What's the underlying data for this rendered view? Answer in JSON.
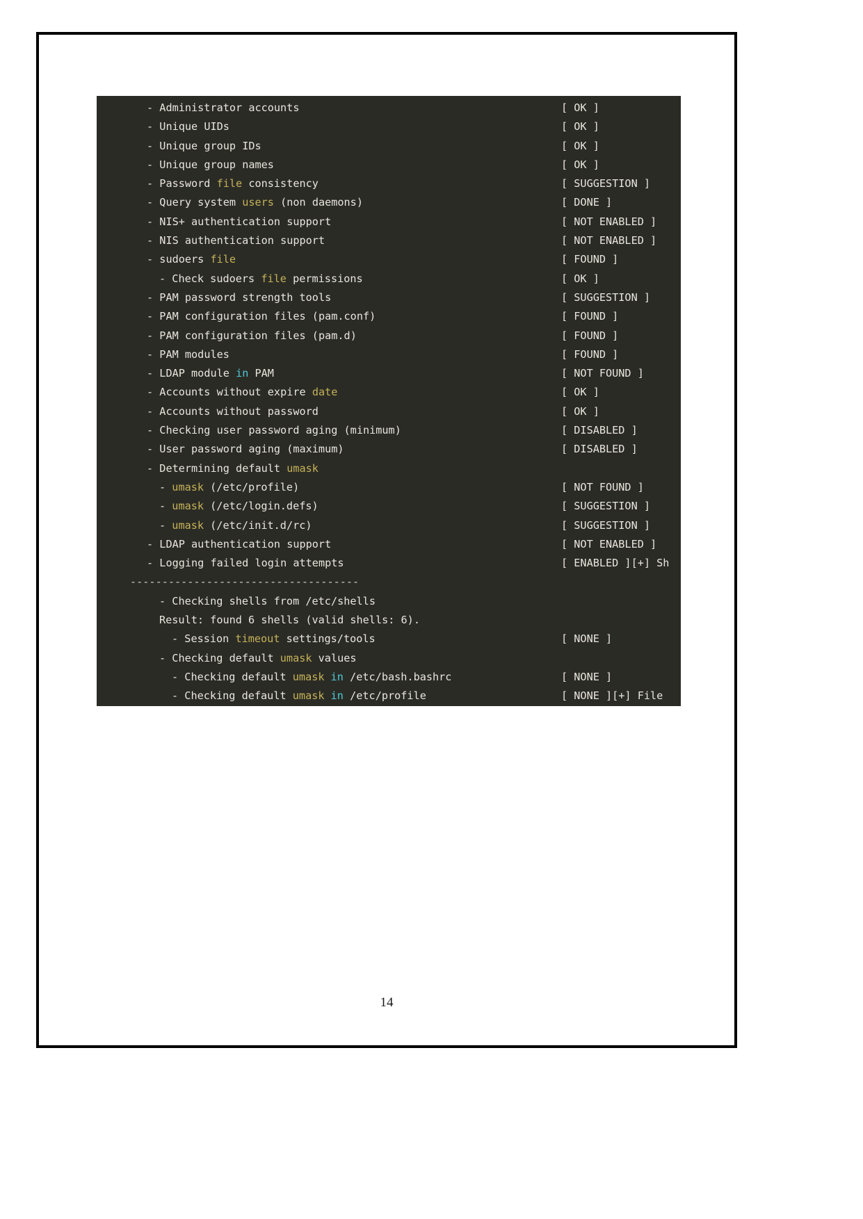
{
  "document": {
    "page_number": "14"
  },
  "terminal": {
    "background_color": "#2b2b26",
    "text_color": "#e8e6dd",
    "highlight_yellow": "#c5b358",
    "highlight_cyan": "#4ec9d6",
    "separator": "------------------------------------",
    "lines": [
      {
        "indent": 1,
        "bullet": "-",
        "text": "Administrator accounts",
        "status": "[ OK ]"
      },
      {
        "indent": 1,
        "bullet": "-",
        "text": "Unique UIDs",
        "status": "[ OK ]"
      },
      {
        "indent": 1,
        "bullet": "-",
        "text": "Unique group IDs",
        "status": "[ OK ]"
      },
      {
        "indent": 1,
        "bullet": "-",
        "text": "Unique group names",
        "status": "[ OK ]"
      },
      {
        "indent": 1,
        "bullet": "-",
        "text": "Password file consistency",
        "status": "[ SUGGESTION ]"
      },
      {
        "indent": 1,
        "bullet": "-",
        "text": "Query system users (non daemons)",
        "status": "[ DONE ]"
      },
      {
        "indent": 1,
        "bullet": "-",
        "text": "NIS+ authentication support",
        "status": "[ NOT ENABLED ]"
      },
      {
        "indent": 1,
        "bullet": "-",
        "text": "NIS authentication support",
        "status": "[ NOT ENABLED ]"
      },
      {
        "indent": 1,
        "bullet": "-",
        "text": "sudoers file",
        "status": "[ FOUND ]"
      },
      {
        "indent": 2,
        "bullet": "-",
        "text": "Check sudoers file permissions",
        "status": "[ OK ]"
      },
      {
        "indent": 1,
        "bullet": "-",
        "text": "PAM password strength tools",
        "status": "[ SUGGESTION ]"
      },
      {
        "indent": 1,
        "bullet": "-",
        "text": "PAM configuration files (pam.conf)",
        "status": "[ FOUND ]"
      },
      {
        "indent": 1,
        "bullet": "-",
        "text": "PAM configuration files (pam.d)",
        "status": "[ FOUND ]"
      },
      {
        "indent": 1,
        "bullet": "-",
        "text": "PAM modules",
        "status": "[ FOUND ]"
      },
      {
        "indent": 1,
        "bullet": "-",
        "text": "LDAP module in PAM",
        "status": "[ NOT FOUND ]"
      },
      {
        "indent": 1,
        "bullet": "-",
        "text": "Accounts without expire date",
        "status": "[ OK ]"
      },
      {
        "indent": 1,
        "bullet": "-",
        "text": "Accounts without password",
        "status": "[ OK ]"
      },
      {
        "indent": 1,
        "bullet": "-",
        "text": "Checking user password aging (minimum)",
        "status": "[ DISABLED ]"
      },
      {
        "indent": 1,
        "bullet": "-",
        "text": "User password aging (maximum)",
        "status": "[ DISABLED ]"
      },
      {
        "indent": 1,
        "bullet": "-",
        "text": "Determining default umask",
        "status": ""
      },
      {
        "indent": 2,
        "bullet": "-",
        "text": "umask (/etc/profile)",
        "status": "[ NOT FOUND ]"
      },
      {
        "indent": 2,
        "bullet": "-",
        "text": "umask (/etc/login.defs)",
        "status": "[ SUGGESTION ]"
      },
      {
        "indent": 2,
        "bullet": "-",
        "text": "umask (/etc/init.d/rc)",
        "status": "[ SUGGESTION ]"
      },
      {
        "indent": 1,
        "bullet": "-",
        "text": "LDAP authentication support",
        "status": "[ NOT ENABLED ]"
      },
      {
        "indent": 1,
        "bullet": "-",
        "text": "Logging failed login attempts",
        "status": "[ ENABLED ][+] Sh"
      },
      {
        "indent": 0,
        "bullet": "",
        "text": "------------------------------------",
        "status": ""
      },
      {
        "indent": 2,
        "bullet": "-",
        "text": "Checking shells from /etc/shells",
        "status": ""
      },
      {
        "indent": 2,
        "bullet": "",
        "text": "Result: found 6 shells (valid shells: 6).",
        "status": ""
      },
      {
        "indent": 3,
        "bullet": "-",
        "text": "Session timeout settings/tools",
        "status": "[ NONE ]"
      },
      {
        "indent": 2,
        "bullet": "-",
        "text": "Checking default umask values",
        "status": ""
      },
      {
        "indent": 3,
        "bullet": "-",
        "text": "Checking default umask in /etc/bash.bashrc",
        "status": "[ NONE ]"
      },
      {
        "indent": 3,
        "bullet": "-",
        "text": "Checking default umask in /etc/profile",
        "status": "[ NONE ][+] File"
      }
    ],
    "keywords_yellow": [
      "file",
      "users",
      "date",
      "umask",
      "timeout"
    ],
    "keywords_cyan": [
      "in"
    ]
  }
}
